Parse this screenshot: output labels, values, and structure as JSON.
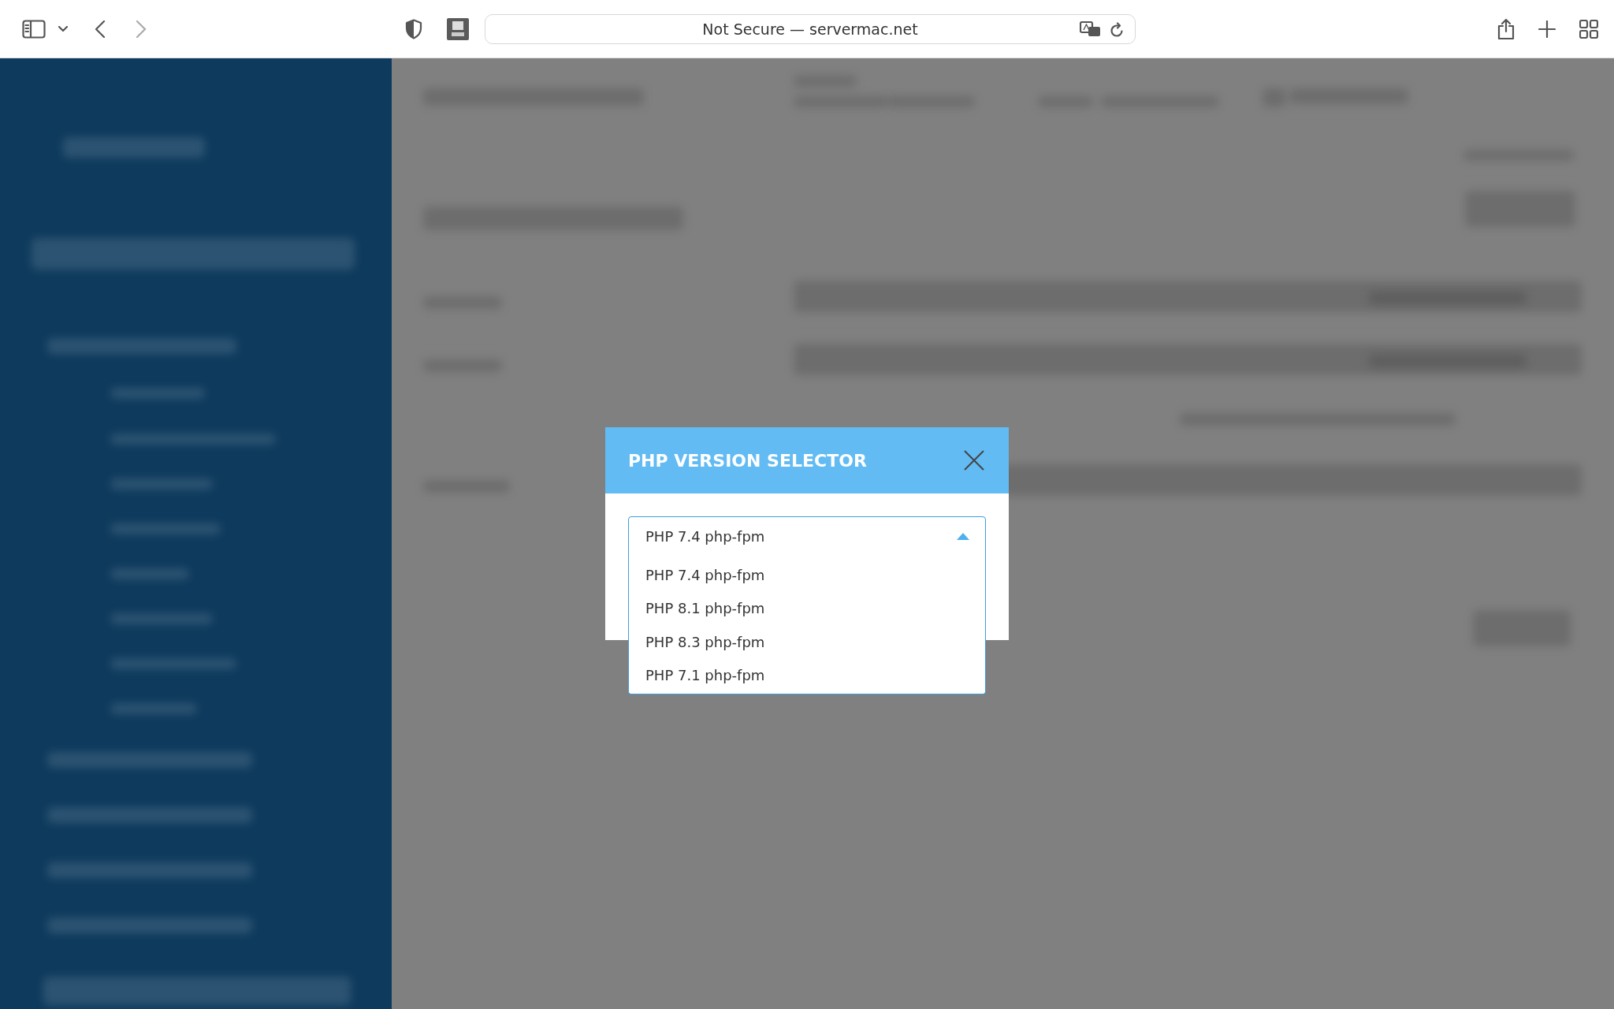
{
  "browser": {
    "address": "Not Secure — servermac.net"
  },
  "modal": {
    "title": "PHP VERSION SELECTOR",
    "select": {
      "value": "PHP 7.4 php-fpm",
      "expanded": true,
      "options": [
        {
          "label": "PHP 7.4 php-fpm"
        },
        {
          "label": "PHP 8.1 php-fpm"
        },
        {
          "label": "PHP 8.3 php-fpm"
        },
        {
          "label": "PHP 7.1 php-fpm"
        }
      ]
    }
  }
}
